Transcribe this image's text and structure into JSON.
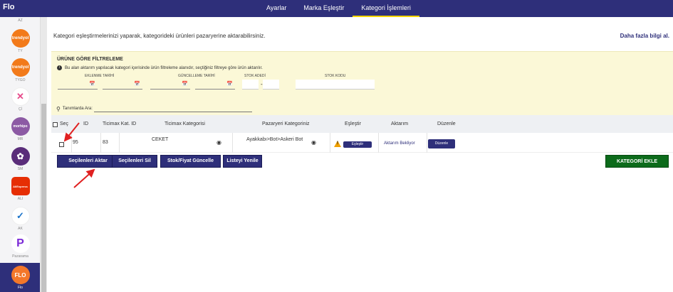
{
  "app": {
    "brand": "Flo"
  },
  "topnav": [
    {
      "label": "Ayarlar"
    },
    {
      "label": "Marka Eşleştir"
    },
    {
      "label": "Kategori İşlemleri"
    }
  ],
  "sidebar": [
    {
      "label": "AZ"
    },
    {
      "label": "TY",
      "logo_text": "trendyol",
      "color": "#f27a1a"
    },
    {
      "label": "TYGO",
      "logo_text": "trendyol",
      "color": "#f27a1a"
    },
    {
      "label": "Çİ",
      "logo_text": "✕",
      "color": "#ffffff"
    },
    {
      "label": "MR",
      "logo_text": "morhipo",
      "color": "#8c5aa4"
    },
    {
      "label": "SM",
      "logo_text": "✿",
      "color": "#5a2d7a"
    },
    {
      "label": "ALI",
      "logo_text": "AliExpress",
      "color": "#e62e04"
    },
    {
      "label": "AK",
      "logo_text": "✓",
      "color": "#ffffff"
    },
    {
      "label": "Pazarama",
      "logo_text": "P",
      "color": "#ffffff"
    },
    {
      "label": "Flo",
      "logo_text": "FLO",
      "color": "#f4772a"
    }
  ],
  "main": {
    "intro": "Kategori eşleştirmelerinizi yaparak, kategorideki ürünleri pazaryerine aktarabilirsiniz.",
    "more_link": "Daha fazla bilgi al.",
    "filter": {
      "title": "ÜRÜNE GÖRE FİLTRELEME",
      "note": "Bu alan aktarım yapılacak kategori içerisinde ürün filtreleme alanıdır, seçtiğiniz filtreye göre ürün aktarılır.",
      "labels": {
        "added_date": "EKLENME TARİHİ",
        "updated_date": "GÜNCELLEME TARİHİ",
        "stock": "STOK ADEDİ",
        "stock_code": "STOK KODU"
      },
      "range_separator": "-"
    },
    "search_label": "Tanımlarda Ara:",
    "table": {
      "headers": [
        "Seç",
        "ID",
        "Ticimax Kat. ID",
        "Ticimax Kategorisi",
        "Pazaryeri Kategoriniz",
        "Eşleştir",
        "Aktarım",
        "Düzenle"
      ],
      "rows": [
        {
          "id": "95",
          "ticimax_id": "83",
          "ticimax_category": "CEKET",
          "marketplace_category": "Ayakkabı>Bot>Askeri Bot",
          "match_button": "Eşleştir",
          "transfer_status": "Aktarım Bekliyor",
          "edit_button": "Düzenle"
        }
      ]
    },
    "actions": {
      "transfer_selected": "Seçilenleri Aktar",
      "delete_selected": "Seçilenleri Sil",
      "update_stock_price": "Stok/Fiyat Güncelle",
      "refresh_list": "Listeyi Yenile",
      "add_category": "KATEGORİ EKLE"
    }
  },
  "colors": {
    "primary": "#2e2f7a",
    "accent": "#f5d400",
    "success": "#0c6b1b",
    "filter_bg": "#fbf8d7",
    "annotation": "#e02020"
  }
}
